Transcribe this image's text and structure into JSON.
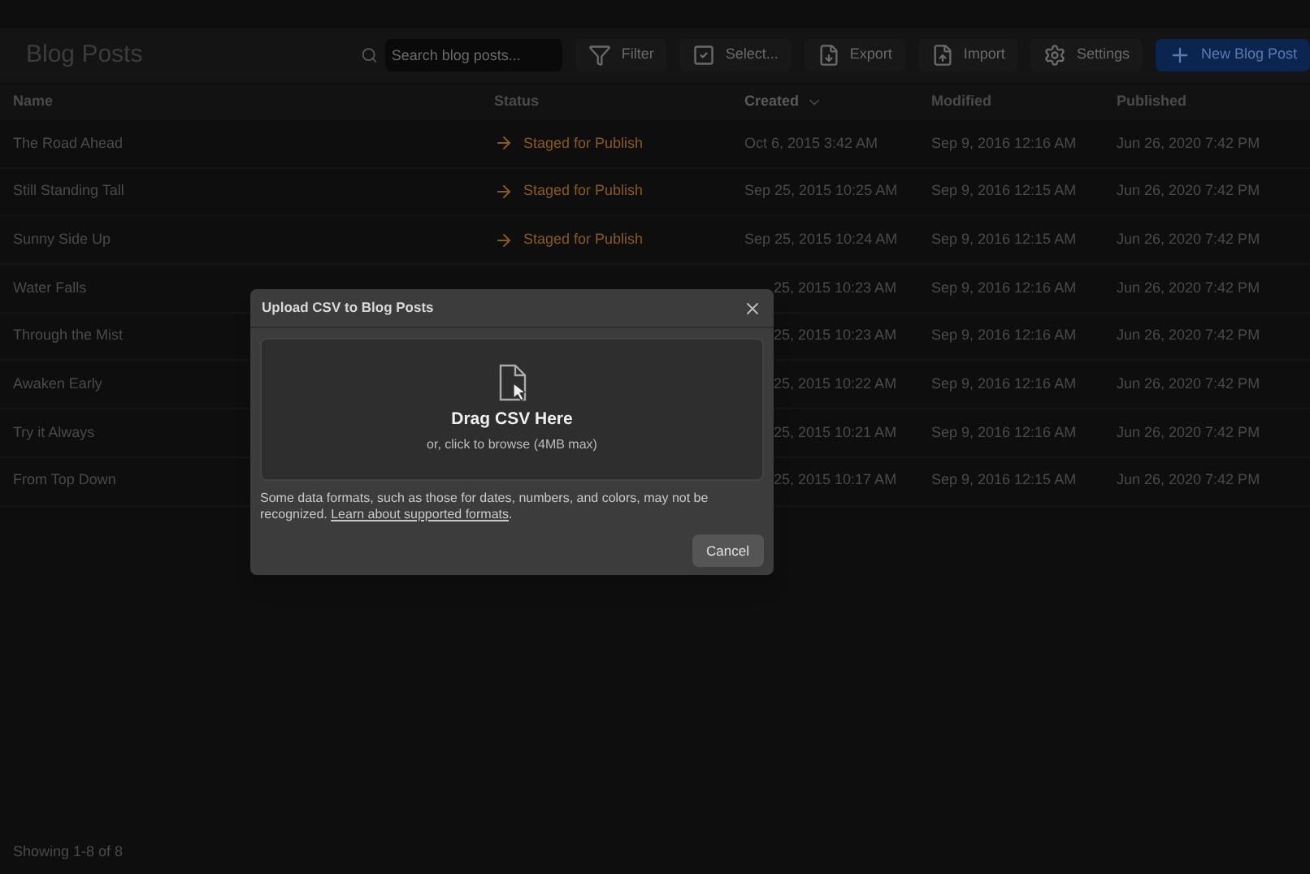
{
  "page": {
    "title": "Blog Posts"
  },
  "search": {
    "placeholder": "Search blog posts..."
  },
  "toolbar": [
    {
      "label": "Filter",
      "kind": "filter"
    },
    {
      "label": "Select...",
      "kind": "select"
    },
    {
      "label": "Export",
      "kind": "export"
    },
    {
      "label": "Import",
      "kind": "import"
    },
    {
      "label": "Settings",
      "kind": "settings"
    },
    {
      "label": "New Blog Post",
      "kind": "primary"
    }
  ],
  "table": {
    "columns": [
      {
        "label": "Name",
        "sorted": false
      },
      {
        "label": "Status",
        "sorted": false
      },
      {
        "label": "Created",
        "sorted": true
      },
      {
        "label": "Modified",
        "sorted": false
      },
      {
        "label": "Published",
        "sorted": false
      }
    ],
    "rows": [
      {
        "name": "The Road Ahead",
        "status": "Staged for Publish",
        "created": "Oct 6, 2015 3:42 AM",
        "modified": "Sep 9, 2016 12:16 AM",
        "published": "Jun 26, 2020 7:42 PM"
      },
      {
        "name": "Still Standing Tall",
        "status": "Staged for Publish",
        "created": "Sep 25, 2015 10:25 AM",
        "modified": "Sep 9, 2016 12:15 AM",
        "published": "Jun 26, 2020 7:42 PM"
      },
      {
        "name": "Sunny Side Up",
        "status": "Staged for Publish",
        "created": "Sep 25, 2015 10:24 AM",
        "modified": "Sep 9, 2016 12:15 AM",
        "published": "Jun 26, 2020 7:42 PM"
      },
      {
        "name": "Water Falls",
        "created": "25, 2015 10:23 AM",
        "modified": "Sep 9, 2016 12:16 AM",
        "published": "Jun 26, 2020 7:42 PM"
      },
      {
        "name": "Through the Mist",
        "created": "25, 2015 10:23 AM",
        "modified": "Sep 9, 2016 12:16 AM",
        "published": "Jun 26, 2020 7:42 PM"
      },
      {
        "name": "Awaken Early",
        "created": "25, 2015 10:22 AM",
        "modified": "Sep 9, 2016 12:16 AM",
        "published": "Jun 26, 2020 7:42 PM"
      },
      {
        "name": "Try it Always",
        "created": "25, 2015 10:21 AM",
        "modified": "Sep 9, 2016 12:16 AM",
        "published": "Jun 26, 2020 7:42 PM"
      },
      {
        "name": "From Top Down",
        "created": "25, 2015 10:17 AM",
        "modified": "Sep 9, 2016 12:15 AM",
        "published": "Jun 26, 2020 7:42 PM"
      }
    ]
  },
  "footer": "Showing 1-8 of 8",
  "dialog": {
    "title": "Upload CSV to Blog Posts",
    "drop_title": "Drag CSV Here",
    "drop_hint": "or, click to browse (4MB max)",
    "note": "Some data formats, such as those for dates, numbers, and colors, may not be recognized.",
    "link": "Learn about supported formats",
    "link_end": ".",
    "cancel": "Cancel"
  }
}
